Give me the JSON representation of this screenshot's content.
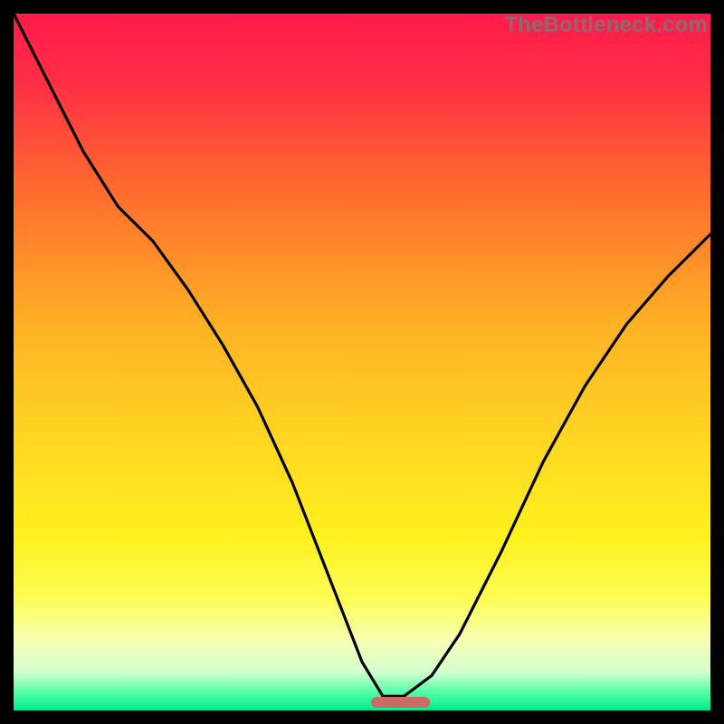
{
  "watermark": "TheBottleneck.com",
  "gradient_stops": [
    {
      "offset": 0.0,
      "color": "#ff1a4b"
    },
    {
      "offset": 0.1,
      "color": "#ff2f44"
    },
    {
      "offset": 0.25,
      "color": "#ff6a2e"
    },
    {
      "offset": 0.45,
      "color": "#ffb224"
    },
    {
      "offset": 0.62,
      "color": "#ffd822"
    },
    {
      "offset": 0.75,
      "color": "#fff11e"
    },
    {
      "offset": 0.84,
      "color": "#fdfd55"
    },
    {
      "offset": 0.9,
      "color": "#f7ffb3"
    },
    {
      "offset": 0.945,
      "color": "#d2ffcf"
    },
    {
      "offset": 0.975,
      "color": "#4fffa3"
    },
    {
      "offset": 1.0,
      "color": "#00e98e"
    }
  ],
  "marker": {
    "x_frac": 0.555,
    "width_frac": 0.085,
    "color": "#cc6a66"
  },
  "chart_data": {
    "type": "line",
    "title": "",
    "xlabel": "",
    "ylabel": "",
    "xlim": [
      0,
      1
    ],
    "ylim": [
      0,
      1
    ],
    "series": [
      {
        "name": "bottleneck-curve",
        "x": [
          0.0,
          0.05,
          0.1,
          0.15,
          0.2,
          0.25,
          0.3,
          0.35,
          0.4,
          0.45,
          0.5,
          0.53,
          0.56,
          0.6,
          0.64,
          0.7,
          0.76,
          0.82,
          0.88,
          0.94,
          1.0
        ],
        "y": [
          1.0,
          0.9,
          0.8,
          0.72,
          0.67,
          0.6,
          0.52,
          0.43,
          0.32,
          0.19,
          0.06,
          0.01,
          0.01,
          0.04,
          0.1,
          0.22,
          0.35,
          0.46,
          0.55,
          0.62,
          0.68
        ]
      }
    ],
    "annotations": [
      {
        "type": "optimal-marker",
        "x_center": 0.555,
        "width": 0.085
      }
    ]
  }
}
